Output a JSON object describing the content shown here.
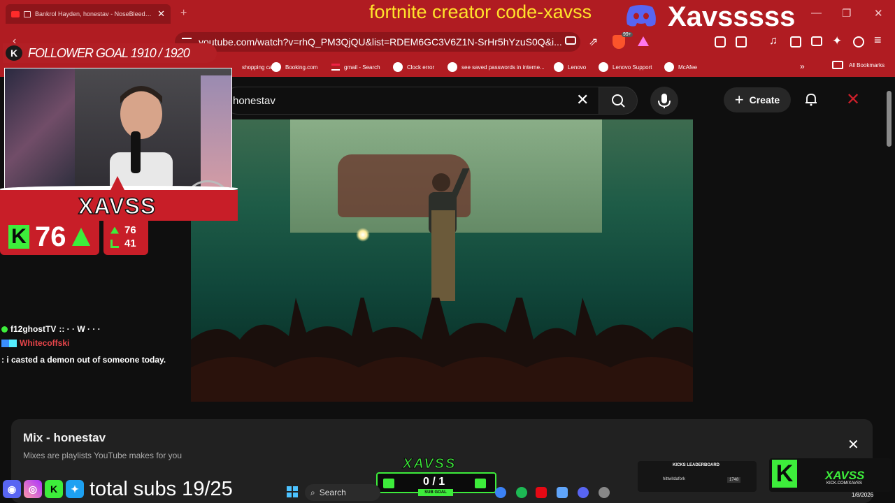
{
  "browser": {
    "tab_title": "Bankrol Hayden, honestav - NoseBleeds (Official",
    "url": "youtube.com/watch?v=rhQ_PM3QjQU&list=RDEM6GC3V6Z1N-SrHr5hYzuS0Q&i...",
    "new_tab_symbol": "+",
    "window_controls": [
      "—",
      "❐",
      "✕"
    ],
    "ext_badge": "99+",
    "bookmarks": [
      "shopping cart",
      "Booking.com",
      "gmail - Search",
      "Clock error",
      "see saved passwords in interne...",
      "Lenovo",
      "Lenovo Support",
      "McAfee"
    ],
    "more_bookmarks": "»",
    "all_bookmarks": "All Bookmarks"
  },
  "stream_overlay": {
    "creator_code": "fortnite creator code-xavss",
    "discord_name": "Xavsssss",
    "follower_goal": "FOLLOWER GOAL 1910 / 1920",
    "banner_name": "XAVSS",
    "kick_count": "76",
    "stats": {
      "up": "76",
      "chart": "41"
    },
    "total_subs": "total subs 19/25",
    "sub_goal_logo": "XAVSS",
    "sub_goal_count": "0 / 1",
    "sub_goal_label": "SUB GOAL",
    "leaderboard_title": "KICKS LEADERBOARD",
    "leaderboard_name": "hittwitdafork",
    "leaderboard_kicks": "1748",
    "brand_name": "XAVSS",
    "brand_url": "KICK.COM/XAVSS"
  },
  "chat": [
    {
      "user": "f12ghostTV",
      "message": ":: · · W · · ·",
      "color": "#ffffff"
    },
    {
      "user": "Whitecoffski",
      "message": ": i casted a demon out of someone today.",
      "color": "#e8454a"
    }
  ],
  "youtube": {
    "search_value": "honestav",
    "create_label": "Create",
    "mix_title": "Mix - honestav",
    "mix_subtitle": "Mixes are playlists YouTube makes for you"
  },
  "taskbar": {
    "search_label": "Search",
    "date": "1/8/2026"
  },
  "colors": {
    "browser_red": "#b01c22",
    "kick_green": "#3ded3b",
    "creator_yellow": "#ffe22b"
  }
}
